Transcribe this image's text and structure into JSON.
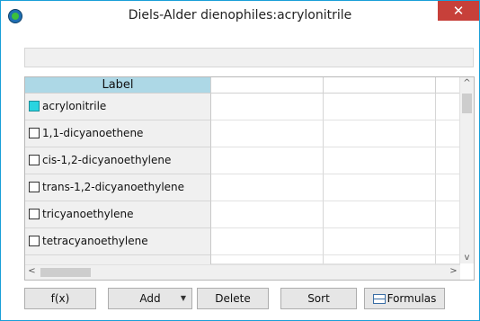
{
  "window": {
    "title": "Diels-Alder dienophiles:acrylonitrile",
    "close_glyph": "✕"
  },
  "input_bar": {
    "value": ""
  },
  "grid": {
    "header": {
      "label_col": "Label"
    },
    "rows": [
      {
        "label": "acrylonitrile",
        "checked": true,
        "check_color": "#2ad4e0"
      },
      {
        "label": "1,1-dicyanoethene",
        "checked": false
      },
      {
        "label": "cis-1,2-dicyanoethylene",
        "checked": false
      },
      {
        "label": "trans-1,2-dicyanoethylene",
        "checked": false
      },
      {
        "label": "tricyanoethylene",
        "checked": false
      },
      {
        "label": "tetracyanoethylene",
        "checked": false
      }
    ],
    "scroll": {
      "up": "^",
      "down": "v",
      "left": "<",
      "right": ">"
    }
  },
  "buttons": {
    "fx": "f(x)",
    "add": "Add",
    "add_dropdown": "▼",
    "delete": "Delete",
    "sort": "Sort",
    "formulas": "Formulas"
  },
  "colors": {
    "header_bg": "#add8e6",
    "close_bg": "#c7403a",
    "window_border": "#1a9fd8"
  }
}
